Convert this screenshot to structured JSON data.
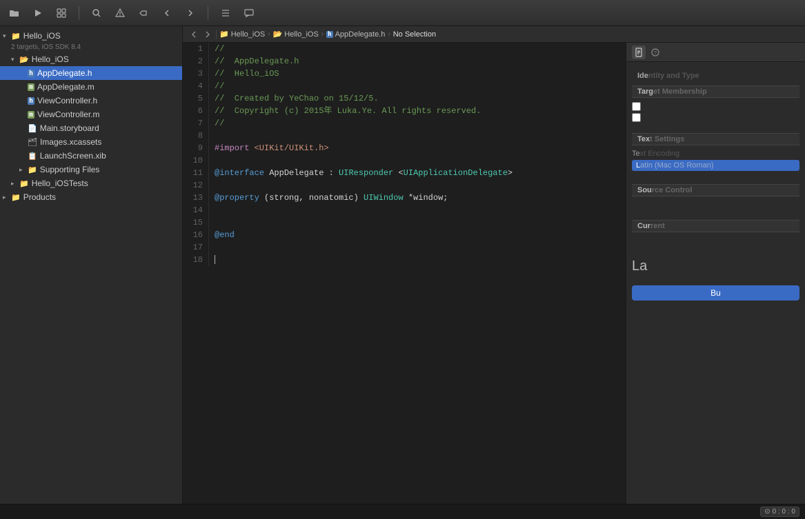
{
  "toolbar": {
    "buttons": [
      {
        "name": "folder-open-icon",
        "icon": "⊞",
        "label": "Navigator"
      },
      {
        "name": "run-icon",
        "icon": "▶",
        "label": "Run"
      },
      {
        "name": "search-icon",
        "icon": "⌕",
        "label": "Search"
      },
      {
        "name": "warning-icon",
        "icon": "⚠",
        "label": "Warnings"
      },
      {
        "name": "breakpoint-icon",
        "icon": "⊘",
        "label": "Breakpoints"
      },
      {
        "name": "back-icon",
        "icon": "↩",
        "label": "Back"
      },
      {
        "name": "forward-icon",
        "icon": "↪",
        "label": "Forward"
      },
      {
        "name": "grid-icon",
        "icon": "⊞",
        "label": "Grid"
      },
      {
        "name": "list-icon",
        "icon": "≡",
        "label": "List"
      },
      {
        "name": "comment-icon",
        "icon": "💬",
        "label": "Comment"
      }
    ]
  },
  "breadcrumb": {
    "items": [
      {
        "name": "Hello_iOS",
        "icon": "📁"
      },
      {
        "name": "Hello_iOS",
        "icon": "📂"
      },
      {
        "name": "AppDelegate.h",
        "icon": "h"
      },
      {
        "name": "No Selection",
        "icon": ""
      }
    ]
  },
  "sidebar": {
    "title": "Hello_iOS",
    "subtitle": "2 targets, iOS SDK 8.4",
    "items": [
      {
        "id": "hello-ios-root",
        "label": "Hello_iOS",
        "indent": 0,
        "triangle": "open",
        "icon": "folder",
        "selected": false
      },
      {
        "id": "hello-ios-group",
        "label": "Hello_iOS",
        "indent": 1,
        "triangle": "open",
        "icon": "folder-blue",
        "selected": false
      },
      {
        "id": "appdelegate-h",
        "label": "AppDelegate.h",
        "indent": 2,
        "triangle": "empty",
        "icon": "h",
        "selected": true
      },
      {
        "id": "appdelegate-m",
        "label": "AppDelegate.m",
        "indent": 2,
        "triangle": "empty",
        "icon": "m",
        "selected": false
      },
      {
        "id": "viewcontroller-h",
        "label": "ViewController.h",
        "indent": 2,
        "triangle": "empty",
        "icon": "h",
        "selected": false
      },
      {
        "id": "viewcontroller-m",
        "label": "ViewController.m",
        "indent": 2,
        "triangle": "empty",
        "icon": "m",
        "selected": false
      },
      {
        "id": "main-storyboard",
        "label": "Main.storyboard",
        "indent": 2,
        "triangle": "empty",
        "icon": "storyboard",
        "selected": false
      },
      {
        "id": "images-xcassets",
        "label": "Images.xcassets",
        "indent": 2,
        "triangle": "empty",
        "icon": "xcassets",
        "selected": false
      },
      {
        "id": "launchscreen-xib",
        "label": "LaunchScreen.xib",
        "indent": 2,
        "triangle": "empty",
        "icon": "xib",
        "selected": false
      },
      {
        "id": "supporting-files",
        "label": "Supporting Files",
        "indent": 2,
        "triangle": "closed",
        "icon": "folder",
        "selected": false
      },
      {
        "id": "hello-ios-tests",
        "label": "Hello_iOSTests",
        "indent": 1,
        "triangle": "closed",
        "icon": "folder",
        "selected": false
      },
      {
        "id": "products",
        "label": "Products",
        "indent": 0,
        "triangle": "closed",
        "icon": "folder",
        "selected": false
      }
    ]
  },
  "editor": {
    "lines": [
      {
        "num": 1,
        "tokens": [
          {
            "cls": "c-comment",
            "text": "//"
          }
        ]
      },
      {
        "num": 2,
        "tokens": [
          {
            "cls": "c-comment",
            "text": "//  AppDelegate.h"
          }
        ]
      },
      {
        "num": 3,
        "tokens": [
          {
            "cls": "c-comment",
            "text": "//  Hello_iOS"
          }
        ]
      },
      {
        "num": 4,
        "tokens": [
          {
            "cls": "c-comment",
            "text": "//"
          }
        ]
      },
      {
        "num": 5,
        "tokens": [
          {
            "cls": "c-comment",
            "text": "//  Created by YeChao on 15/12/5."
          }
        ]
      },
      {
        "num": 6,
        "tokens": [
          {
            "cls": "c-comment",
            "text": "//  Copyright (c) 2015年 Luka.Ye. All rights reserved."
          }
        ]
      },
      {
        "num": 7,
        "tokens": [
          {
            "cls": "c-comment",
            "text": "//"
          }
        ]
      },
      {
        "num": 8,
        "tokens": []
      },
      {
        "num": 9,
        "tokens": [
          {
            "cls": "c-preprocessor",
            "text": "#import "
          },
          {
            "cls": "c-string",
            "text": "<UIKit/UIKit.h>"
          }
        ]
      },
      {
        "num": 10,
        "tokens": []
      },
      {
        "num": 11,
        "tokens": [
          {
            "cls": "c-blue",
            "text": "@interface"
          },
          {
            "cls": "c-plain",
            "text": " AppDelegate : "
          },
          {
            "cls": "c-type",
            "text": "UIResponder"
          },
          {
            "cls": "c-plain",
            "text": " <"
          },
          {
            "cls": "c-protocol",
            "text": "UIApplicationDelegate"
          },
          {
            "cls": "c-plain",
            "text": ">"
          }
        ]
      },
      {
        "num": 12,
        "tokens": []
      },
      {
        "num": 13,
        "tokens": [
          {
            "cls": "c-blue",
            "text": "@property"
          },
          {
            "cls": "c-plain",
            "text": " (strong, nonatomic) "
          },
          {
            "cls": "c-type",
            "text": "UIWindow"
          },
          {
            "cls": "c-plain",
            "text": " *window;"
          }
        ]
      },
      {
        "num": 14,
        "tokens": []
      },
      {
        "num": 15,
        "tokens": []
      },
      {
        "num": 16,
        "tokens": [
          {
            "cls": "c-blue",
            "text": "@end"
          }
        ]
      },
      {
        "num": 17,
        "tokens": []
      },
      {
        "num": 18,
        "tokens": [
          {
            "cls": "c-plain",
            "text": ""
          }
        ]
      }
    ]
  },
  "right_panel": {
    "title": "Ide",
    "sections": [
      {
        "name": "Target Membership",
        "short": "Targ",
        "items": [
          {
            "label": "",
            "type": "checkbox",
            "checked": false
          },
          {
            "label": "",
            "type": "checkbox",
            "checked": false
          }
        ]
      },
      {
        "name": "Text Settings",
        "short": "Tex",
        "items": [
          {
            "label": "Te",
            "type": "label"
          },
          {
            "label": "L",
            "type": "blue-input"
          },
          {
            "label": "",
            "type": "text"
          }
        ]
      },
      {
        "name": "Source Control",
        "short": "Sou",
        "items": []
      },
      {
        "name": "Current",
        "short": "Cur",
        "items": []
      },
      {
        "name": "La",
        "short": "La",
        "items": []
      },
      {
        "name": "Bu",
        "short": "Bu",
        "items": []
      }
    ]
  },
  "bottom_bar": {
    "status": "0 : 0 : 0"
  }
}
